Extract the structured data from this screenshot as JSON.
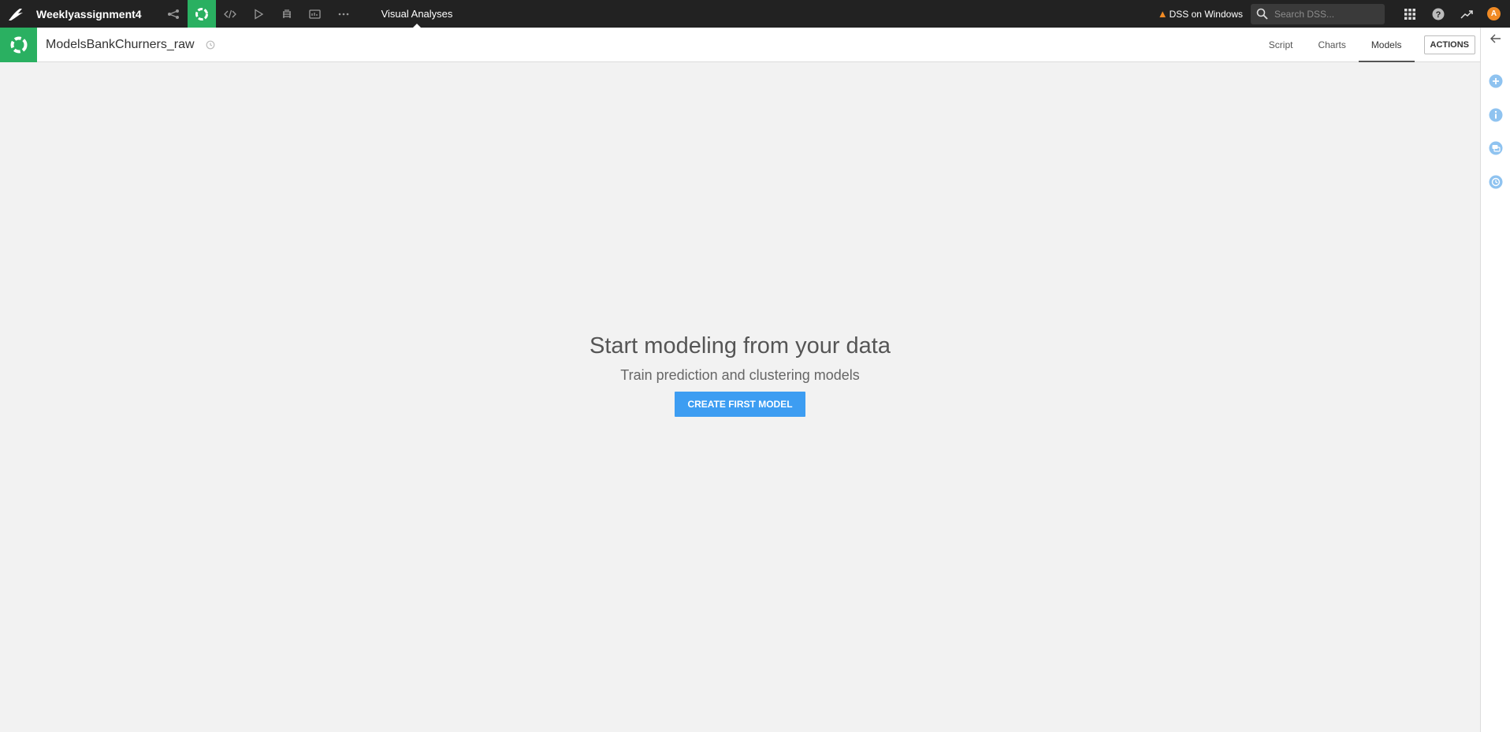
{
  "topbar": {
    "project_name": "Weeklyassignment4",
    "nav_icons": [
      "flow-icon",
      "analysis-icon",
      "code-icon",
      "run-icon",
      "library-icon",
      "dashboard-icon",
      "more-icon"
    ],
    "section_label": "Visual Analyses",
    "warning_text": "DSS on Windows",
    "search_placeholder": "Search DSS...",
    "avatar_initial": "A"
  },
  "header": {
    "title": "ModelsBankChurners_raw",
    "tabs": [
      {
        "label": "Script",
        "active": false
      },
      {
        "label": "Charts",
        "active": false
      },
      {
        "label": "Models",
        "active": true
      }
    ],
    "actions_label": "ACTIONS"
  },
  "empty_state": {
    "title": "Start modeling from your data",
    "subtitle": "Train prediction and clustering models",
    "button_label": "CREATE FIRST MODEL"
  },
  "colors": {
    "topbar_bg": "#222222",
    "accent_green": "#2ab061",
    "primary_button": "#3d9df2",
    "warning": "#f08a24",
    "sidebar_icon": "#8fc3f0"
  }
}
